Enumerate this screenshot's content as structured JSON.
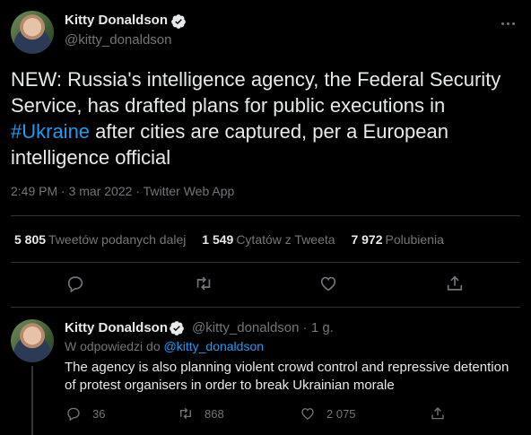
{
  "tweet": {
    "author_name": "Kitty Donaldson",
    "author_handle": "@kitty_donaldson",
    "text_before": "NEW: Russia's intelligence agency, the Federal Security Service, has drafted plans for public executions in ",
    "hashtag": "#Ukraine",
    "text_after": " after cities are captured, per a European intelligence official",
    "timestamp": "2:49 PM · 3 mar 2022 · Twitter Web App",
    "stats": {
      "retweets_count": "5 805",
      "retweets_label": "Tweetów podanych dalej",
      "quotes_count": "1 549",
      "quotes_label": "Cytatów z Tweeta",
      "likes_count": "7 972",
      "likes_label": "Polubienia"
    },
    "icons": [
      "reply-icon",
      "retweet-icon",
      "like-icon",
      "share-icon",
      "more-icon",
      "verified-icon"
    ]
  },
  "reply": {
    "author_name": "Kitty Donaldson",
    "author_handle": "@kitty_donaldson",
    "age": "1 g.",
    "reply_to_prefix": "W odpowiedzi do",
    "reply_to_mention": "@kitty_donaldson",
    "text": "The agency is also planning violent crowd control and repressive detention of protest organisers in order to break Ukrainian morale",
    "replies": "36",
    "retweets": "868",
    "likes": "2 075"
  },
  "colors": {
    "background": "#000000",
    "text": "#e7e9ea",
    "muted": "#71767b",
    "accent": "#1d9bf0",
    "divider": "#2f3336"
  }
}
